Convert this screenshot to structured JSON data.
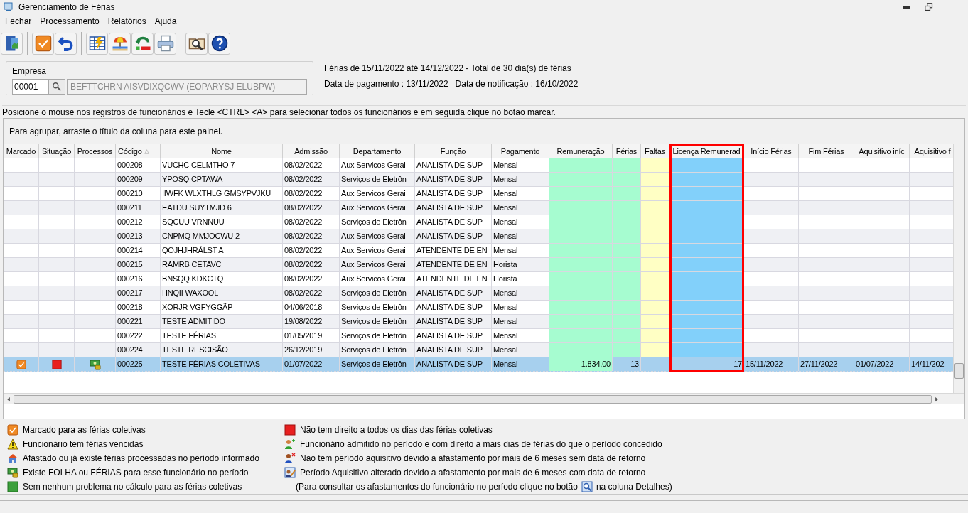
{
  "window": {
    "title": "Gerenciamento de Férias"
  },
  "menu": [
    "Fechar",
    "Processamento",
    "Relatórios",
    "Ajuda"
  ],
  "company": {
    "label": "Empresa",
    "code": "00001",
    "name": "BEFTTCHRN AISVDIXQCWV (EOPARYSJ ELUBPW)"
  },
  "info": [
    "Férias de 15/11/2022 até 14/12/2022 - Total de 30 dia(s) de férias",
    "Data de pagamento : 13/11/2022   Data de notificação : 16/10/2022"
  ],
  "instruction": "Posicione o mouse nos registros de funcionários e Tecle <CTRL> <A> para selecionar todos os funcionários e em seguida clique no botão marcar.",
  "group_panel": "Para agrupar, arraste o título da coluna para este painel.",
  "table": {
    "columns": [
      {
        "label": "Marcado",
        "kind": "check",
        "sorted": false,
        "highlighted": false
      },
      {
        "label": "Situação",
        "kind": "status",
        "sorted": false,
        "highlighted": false
      },
      {
        "label": "Processos",
        "kind": "process",
        "sorted": false,
        "highlighted": false
      },
      {
        "label": "Código",
        "kind": "text",
        "sorted": true,
        "highlighted": false
      },
      {
        "label": "Nome",
        "kind": "text",
        "sorted": false,
        "highlighted": false
      },
      {
        "label": "Admissão",
        "kind": "text",
        "sorted": false,
        "highlighted": false
      },
      {
        "label": "Departamento",
        "kind": "text",
        "sorted": false,
        "highlighted": false
      },
      {
        "label": "Função",
        "kind": "text",
        "sorted": false,
        "highlighted": false
      },
      {
        "label": "Pagamento",
        "kind": "text",
        "sorted": false,
        "highlighted": false
      },
      {
        "label": "Remuneração",
        "kind": "number",
        "sorted": false,
        "highlighted": false
      },
      {
        "label": "Férias",
        "kind": "number",
        "sorted": false,
        "highlighted": false
      },
      {
        "label": "Faltas",
        "kind": "number",
        "sorted": false,
        "highlighted": false
      },
      {
        "label": "Licença Remunerad",
        "kind": "number",
        "sorted": false,
        "highlighted": true
      },
      {
        "label": "Início Férias",
        "kind": "text",
        "sorted": false,
        "highlighted": false
      },
      {
        "label": "Fim Férias",
        "kind": "text",
        "sorted": false,
        "highlighted": false
      },
      {
        "label": "Aquisitivo iníc",
        "kind": "text",
        "sorted": false,
        "highlighted": false
      },
      {
        "label": "Aquisitivo f",
        "kind": "text",
        "sorted": false,
        "highlighted": false
      }
    ],
    "rows": [
      {
        "selected": false,
        "marked": false,
        "processes": false,
        "code": "000208",
        "name": "VUCHC CELMTHO 7",
        "admission": "08/02/2022",
        "department": "Aux Servicos Gerai",
        "role": "ANALISTA DE SUP",
        "payment": "Mensal"
      },
      {
        "selected": false,
        "marked": false,
        "processes": false,
        "code": "000209",
        "name": "YPOSQ CPTAWA",
        "admission": "08/02/2022",
        "department": "Serviços de Eletrôn",
        "role": "ANALISTA DE SUP",
        "payment": "Mensal"
      },
      {
        "selected": false,
        "marked": false,
        "processes": false,
        "code": "000210",
        "name": "IIWFK WLXTHLG GMSYPVJKU",
        "admission": "08/02/2022",
        "department": "Aux Servicos Gerai",
        "role": "ANALISTA DE SUP",
        "payment": "Mensal"
      },
      {
        "selected": false,
        "marked": false,
        "processes": false,
        "code": "000211",
        "name": "EATDU SUYTMJD 6",
        "admission": "08/02/2022",
        "department": "Aux Servicos Gerai",
        "role": "ANALISTA DE SUP",
        "payment": "Mensal"
      },
      {
        "selected": false,
        "marked": false,
        "processes": false,
        "code": "000212",
        "name": "SQCUU VRNNUU",
        "admission": "08/02/2022",
        "department": "Serviços de Eletrôn",
        "role": "ANALISTA DE SUP",
        "payment": "Mensal"
      },
      {
        "selected": false,
        "marked": false,
        "processes": false,
        "code": "000213",
        "name": "CNPMQ MMJOCWU 2",
        "admission": "08/02/2022",
        "department": "Aux Servicos Gerai",
        "role": "ANALISTA DE SUP",
        "payment": "Mensal"
      },
      {
        "selected": false,
        "marked": false,
        "processes": false,
        "code": "000214",
        "name": "QOJHJHRÁLST A",
        "admission": "08/02/2022",
        "department": "Aux Servicos Gerai",
        "role": "ATENDENTE DE EN",
        "payment": "Mensal"
      },
      {
        "selected": false,
        "marked": false,
        "processes": false,
        "code": "000215",
        "name": "RAMRB CETAVC",
        "admission": "08/02/2022",
        "department": "Aux Servicos Gerai",
        "role": "ATENDENTE DE EN",
        "payment": "Horista"
      },
      {
        "selected": false,
        "marked": false,
        "processes": false,
        "code": "000216",
        "name": "BNSQQ KDKCTQ",
        "admission": "08/02/2022",
        "department": "Aux Servicos Gerai",
        "role": "ATENDENTE DE EN",
        "payment": "Horista"
      },
      {
        "selected": false,
        "marked": false,
        "processes": false,
        "code": "000217",
        "name": "HNQII WAXOOL",
        "admission": "08/02/2022",
        "department": "Serviços de Eletrôn",
        "role": "ANALISTA DE SUP",
        "payment": "Mensal"
      },
      {
        "selected": false,
        "marked": false,
        "processes": false,
        "code": "000218",
        "name": "XORJR VGFYGGÃP",
        "admission": "04/06/2018",
        "department": "Serviços de Eletrôn",
        "role": "ANALISTA DE SUP",
        "payment": "Mensal"
      },
      {
        "selected": false,
        "marked": false,
        "processes": false,
        "code": "000221",
        "name": "TESTE ADMITIDO",
        "admission": "19/08/2022",
        "department": "Serviços de Eletrôn",
        "role": "ANALISTA DE SUP",
        "payment": "Mensal"
      },
      {
        "selected": false,
        "marked": false,
        "processes": false,
        "code": "000222",
        "name": "TESTE FÉRIAS",
        "admission": "01/05/2019",
        "department": "Serviços de Eletrôn",
        "role": "ANALISTA DE SUP",
        "payment": "Mensal"
      },
      {
        "selected": false,
        "marked": false,
        "processes": false,
        "code": "000224",
        "name": "TESTE RESCISÃO",
        "admission": "26/12/2019",
        "department": "Serviços de Eletrôn",
        "role": "ANALISTA DE SUP",
        "payment": "Mensal"
      },
      {
        "selected": true,
        "marked": true,
        "not_entitled": true,
        "processes": true,
        "code": "000225",
        "name": "TESTE FÉRIAS COLETIVAS",
        "admission": "01/07/2022",
        "department": "Serviços de Eletrôn",
        "role": "ANALISTA DE SUP",
        "payment": "Mensal",
        "remuneration": "1.834,00",
        "vacation_days": "13",
        "paid_leave": "17",
        "vacation_start": "15/11/2022",
        "vacation_end": "27/11/2022",
        "acq_start": "01/07/2022",
        "acq_end": "14/11/202"
      }
    ]
  },
  "legend": [
    {
      "kind": "marked",
      "text": "Marcado para as férias coletivas"
    },
    {
      "kind": "warning",
      "text": "Funcionário tem férias vencidas"
    },
    {
      "kind": "house",
      "text": "Afastado ou já existe férias processadas no período informado"
    },
    {
      "kind": "money",
      "text": "Existe FOLHA ou FÉRIAS para esse funcionário no período"
    },
    {
      "kind": "green",
      "text": "Sem nenhum problema no cálculo para as férias coletivas"
    },
    {
      "kind": "red",
      "text": "Não tem direito a todos os dias das férias coletivas"
    },
    {
      "kind": "person_plus",
      "text": "Funcionário admitido no período e com direito a mais dias de férias do que o período concedido"
    },
    {
      "kind": "person_x",
      "text": "Não tem período aquisitivo devido a afastamento por mais de 6 meses sem data de retorno"
    },
    {
      "kind": "edit",
      "text": "Período Aquisitivo alterado devido a afastamento por mais de 6 meses com data de retorno"
    }
  ],
  "legend_note": {
    "before": "(Para consultar os afastamentos do funcionário no período clique no botão",
    "after": "na coluna Detalhes)"
  }
}
